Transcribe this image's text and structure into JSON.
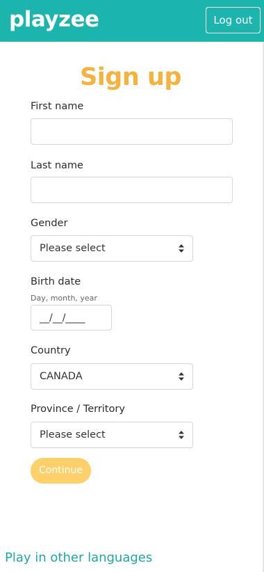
{
  "header": {
    "logo_text": "playzee",
    "logout_label": "Log out",
    "brand_color": "#1cb5ad"
  },
  "form": {
    "title": "Sign up",
    "title_color": "#f7b23b",
    "first_name": {
      "label": "First name",
      "value": ""
    },
    "last_name": {
      "label": "Last name",
      "value": ""
    },
    "gender": {
      "label": "Gender",
      "selected": "Please select"
    },
    "birth_date": {
      "label": "Birth date",
      "hint": "Day, month, year",
      "value": "__/__/____"
    },
    "country": {
      "label": "Country",
      "selected": "CANADA"
    },
    "province": {
      "label": "Province / Territory",
      "selected": "Please select"
    },
    "continue_label": "Continue",
    "continue_color": "#fdd06a"
  },
  "footer": {
    "languages_link": "Play in other languages",
    "link_color": "#1aa9a3"
  },
  "icons": {
    "select_arrow": "select-arrows-icon"
  }
}
